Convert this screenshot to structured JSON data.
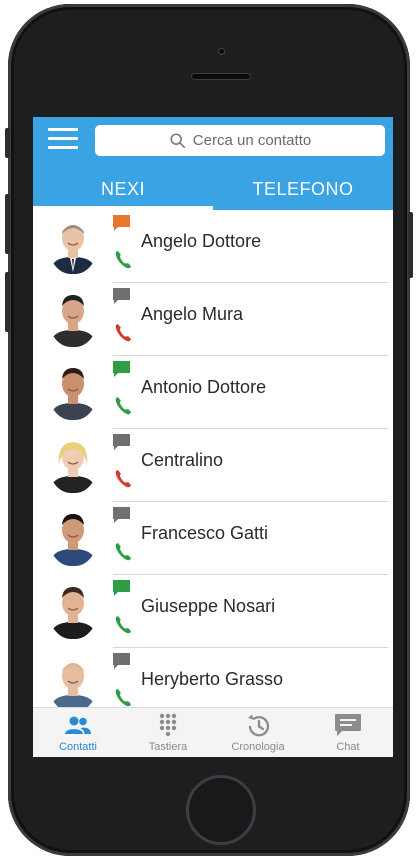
{
  "search": {
    "placeholder": "Cerca un contatto"
  },
  "tabs": [
    {
      "label": "NEXI",
      "active": true
    },
    {
      "label": "TELEFONO",
      "active": false
    }
  ],
  "contacts": [
    {
      "name": "Angelo Dottore",
      "chat_status": "orange",
      "phone_status": "green"
    },
    {
      "name": "Angelo Mura",
      "chat_status": "gray",
      "phone_status": "red"
    },
    {
      "name": "Antonio Dottore",
      "chat_status": "green",
      "phone_status": "green"
    },
    {
      "name": "Centralino",
      "chat_status": "gray",
      "phone_status": "red"
    },
    {
      "name": "Francesco Gatti",
      "chat_status": "gray",
      "phone_status": "green"
    },
    {
      "name": "Giuseppe Nosari",
      "chat_status": "green",
      "phone_status": "green"
    },
    {
      "name": "Heryberto Grasso",
      "chat_status": "gray",
      "phone_status": "green"
    }
  ],
  "bottom_nav": [
    {
      "label": "Contatti",
      "icon": "contacts-icon",
      "active": true
    },
    {
      "label": "Tastiera",
      "icon": "keypad-icon",
      "active": false
    },
    {
      "label": "Cronologia",
      "icon": "history-icon",
      "active": false
    },
    {
      "label": "Chat",
      "icon": "chat-icon",
      "active": false
    }
  ],
  "colors": {
    "header": "#3aa3e3",
    "accent": "#2a8ad6",
    "status_green": "#2e9e44",
    "status_red": "#d33a2c",
    "status_orange": "#e8772e",
    "status_gray": "#707070"
  }
}
